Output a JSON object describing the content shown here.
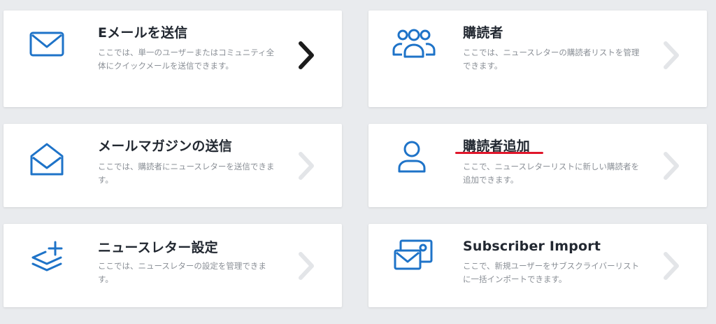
{
  "cards": [
    {
      "title": "Eメールを送信",
      "desc": "ここでは、単一のユーザーまたはコミュニティ全体にクイックメールを送信できます。",
      "icon": "envelope-icon",
      "chevron": "dark"
    },
    {
      "title": "購読者",
      "desc": "ここでは、ニュースレターの購読者リストを管理できます。",
      "icon": "users-group-icon",
      "chevron": "light"
    },
    {
      "title": "メールマガジンの送信",
      "desc": "ここでは、購読者にニュースレターを送信できます。",
      "icon": "open-envelope-icon",
      "chevron": "light"
    },
    {
      "title": "購読者追加",
      "desc": "ここで、ニュースレターリストに新しい購読者を追加できます。",
      "icon": "user-icon",
      "chevron": "light",
      "highlight_color": "#e0162b"
    },
    {
      "title": "ニュースレター設定",
      "desc": "ここでは、ニュースレターの設定を管理できます。",
      "icon": "layers-plus-icon",
      "chevron": "light"
    },
    {
      "title": "Subscriber Import",
      "desc": "ここで、新規ユーザーをサブスクライバーリストに一括インポートできます。",
      "icon": "import-envelopes-icon",
      "chevron": "light"
    }
  ],
  "colors": {
    "accent": "#1e73c8",
    "chevron_dark": "#1c1c1c",
    "chevron_light": "#e3e5e8",
    "background": "#e9ebee"
  }
}
